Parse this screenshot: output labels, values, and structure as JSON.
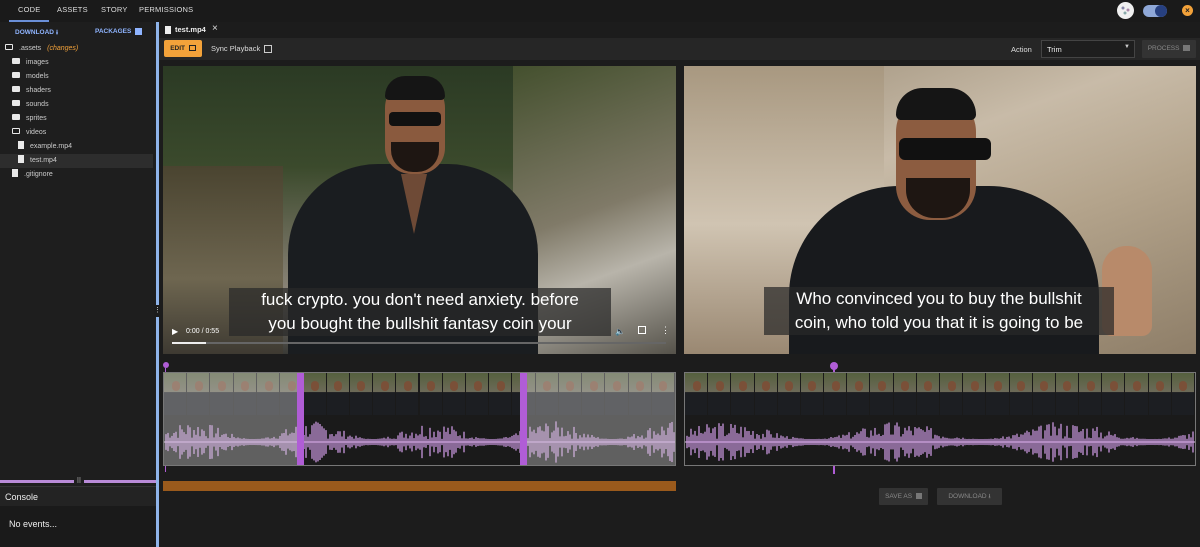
{
  "top_tabs": [
    "CODE",
    "ASSETS",
    "STORY",
    "PERMISSIONS"
  ],
  "sidebar": {
    "download_label": "DOWNLOAD",
    "packages_label": "PACKAGES",
    "tree": [
      {
        "label": ".assets",
        "extra": "(changes)",
        "kind": "folder-open"
      },
      {
        "label": "images",
        "kind": "folder"
      },
      {
        "label": "models",
        "kind": "folder"
      },
      {
        "label": "shaders",
        "kind": "folder"
      },
      {
        "label": "sounds",
        "kind": "folder"
      },
      {
        "label": "sprites",
        "kind": "folder"
      },
      {
        "label": "videos",
        "kind": "folder-open"
      },
      {
        "label": "example.mp4",
        "kind": "file"
      },
      {
        "label": "test.mp4",
        "kind": "file",
        "selected": true
      },
      {
        "label": ".gitignore",
        "kind": "file"
      }
    ]
  },
  "console": {
    "title": "Console",
    "empty_text": "No events..."
  },
  "editor": {
    "tab_label": "test.mp4",
    "edit_label": "EDIT",
    "sync_label": "Sync Playback",
    "action_label": "Action",
    "action_value": "Trim",
    "process_label": "PROCESS",
    "left_caption": [
      "fuck crypto. you don't need anxiety. before",
      "you bought the bullshit fantasy coin your"
    ],
    "right_caption": [
      "Who convinced you to buy the bullshit",
      "coin, who told you that it is going to be"
    ],
    "time_display": "0:00 / 0:55",
    "save_as_label": "SAVE AS",
    "download_label": "DOWNLOAD",
    "colors": {
      "accent": "#f3a23a",
      "handle": "#b05dd6",
      "splitter": "#8fb4ea",
      "progress": "#9a5a1c"
    }
  }
}
